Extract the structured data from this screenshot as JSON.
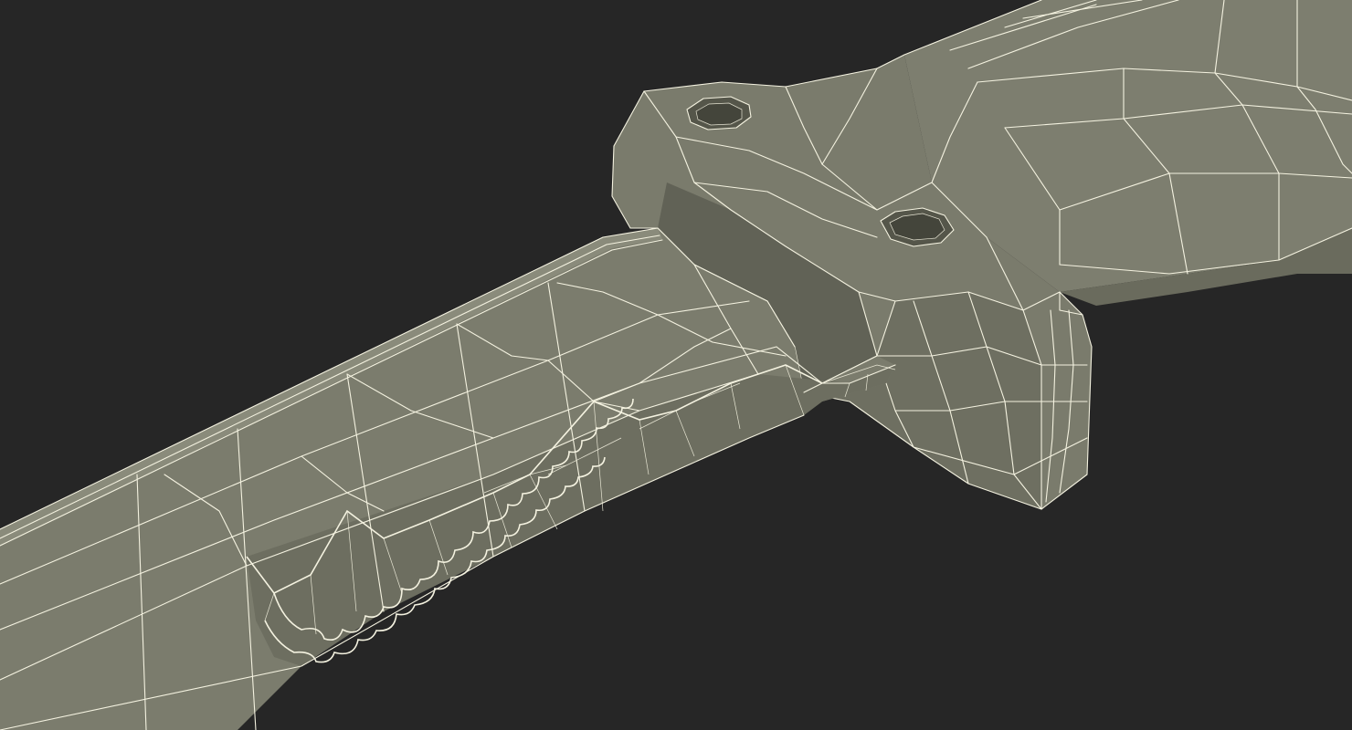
{
  "scene": {
    "subject": "knife-wireframe-model",
    "background_color": "#262626",
    "surface_color": "#7a7b6c",
    "surface_shadow_color": "#5e5f52",
    "wire_color": "#f4f2e0"
  }
}
